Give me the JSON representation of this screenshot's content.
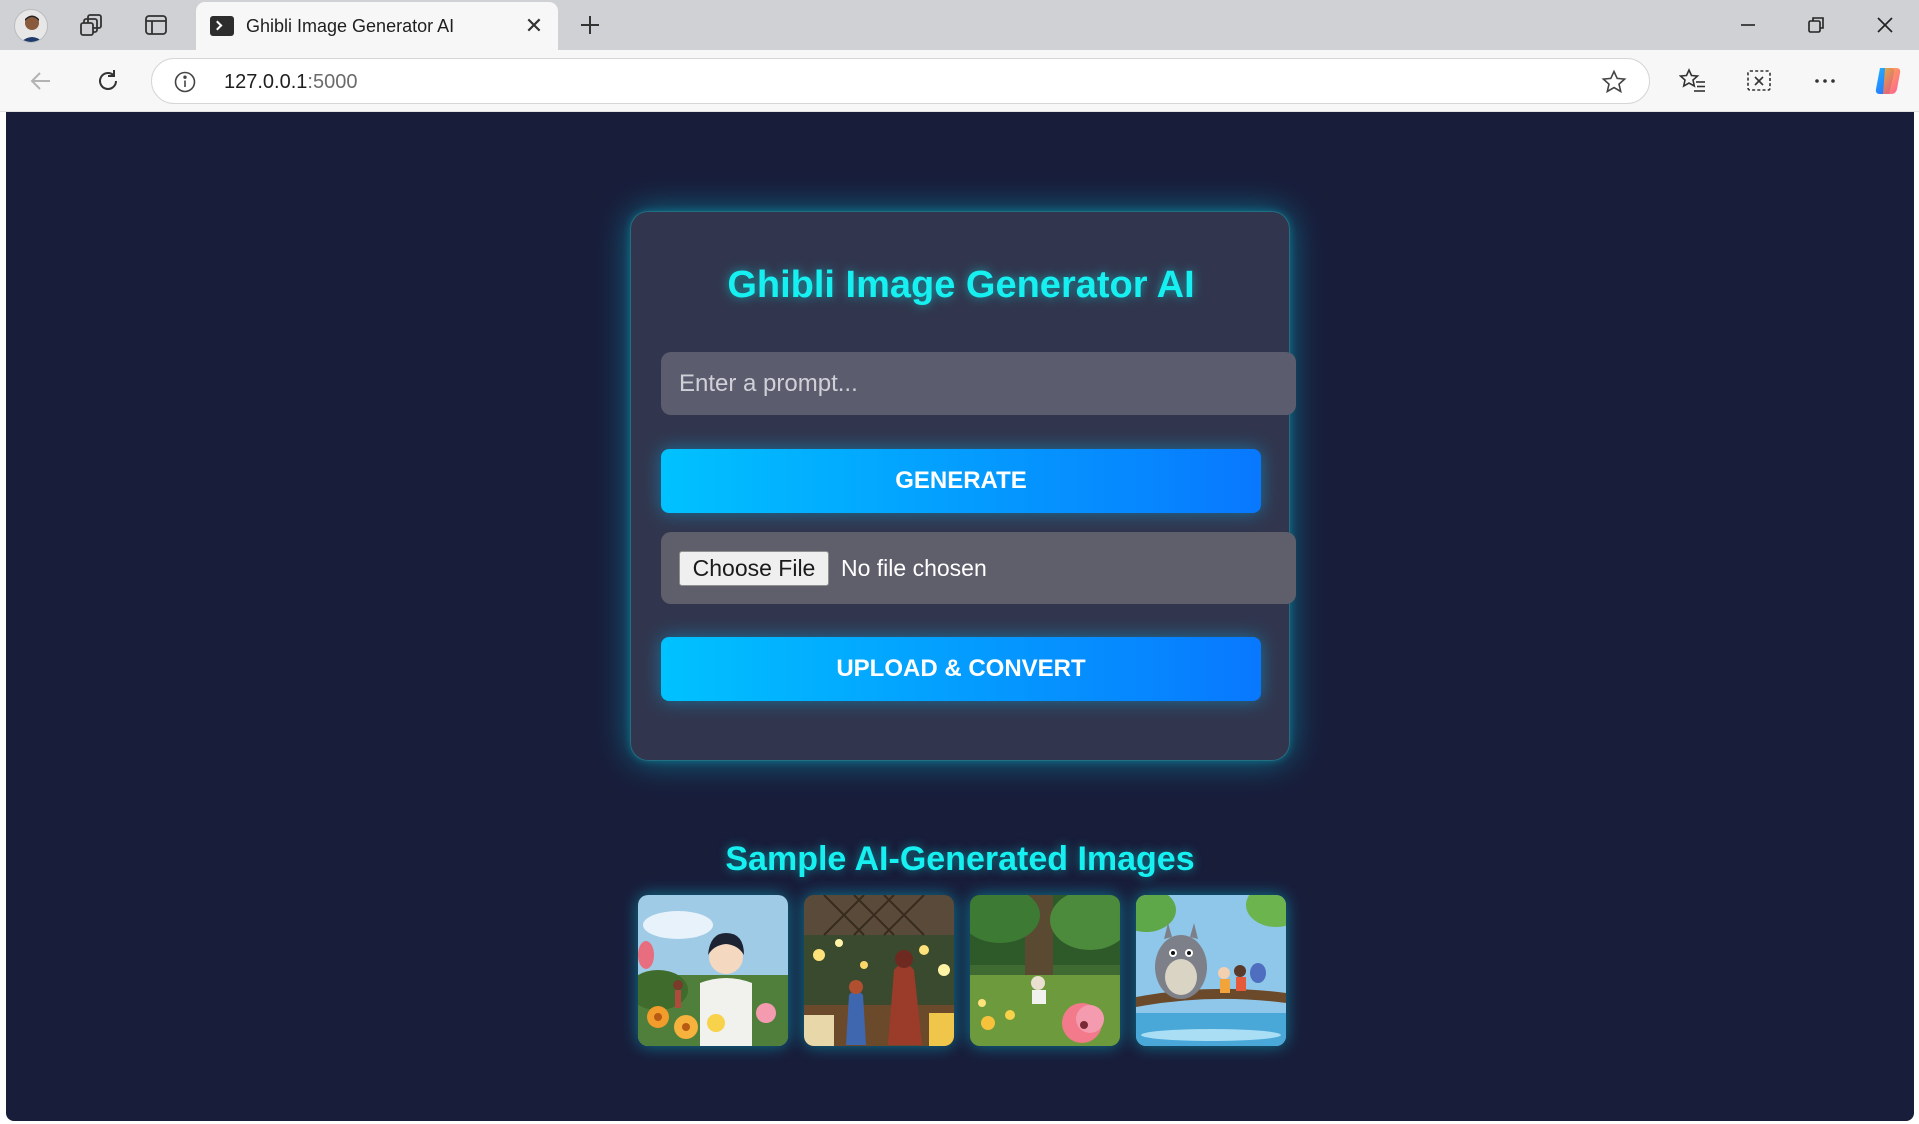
{
  "browser": {
    "tab_title": "Ghibli Image Generator AI",
    "url_host": "127.0.0.1",
    "url_port": ":5000"
  },
  "app": {
    "title": "Ghibli Image Generator AI",
    "prompt_placeholder": "Enter a prompt...",
    "generate_label": "GENERATE",
    "file_button_label": "Choose File",
    "file_status": "No file chosen",
    "upload_label": "UPLOAD & CONVERT"
  },
  "samples": {
    "title": "Sample AI-Generated Images",
    "images": [
      {
        "name": "boy-with-flowers"
      },
      {
        "name": "garden-lanterns-scene"
      },
      {
        "name": "forest-meadow-with-poppies"
      },
      {
        "name": "totoro-on-branch"
      }
    ]
  },
  "colors": {
    "page_background": "#181d3a",
    "accent_cyan": "#16f0f0",
    "button_gradient_start": "#00c2ff",
    "button_gradient_end": "#0878ff"
  }
}
